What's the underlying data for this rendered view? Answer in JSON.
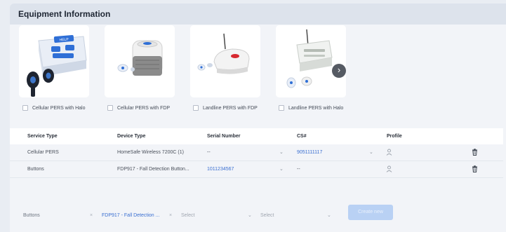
{
  "header": {
    "title": "Equipment Information"
  },
  "carousel": {
    "items": [
      {
        "label": "Cellular PERS with Halo"
      },
      {
        "label": "Cellular PERS with FDP"
      },
      {
        "label": "Landline PERS with FDP"
      },
      {
        "label": "Landline PERS with Halo"
      }
    ],
    "product_text": {
      "help": "HELP"
    }
  },
  "table": {
    "columns": [
      "Service Type",
      "Device Type",
      "Serial Number",
      "CS#",
      "Profile"
    ],
    "rows": [
      {
        "service_type": "Cellular PERS",
        "device_type": "HomeSafe Wireless 7200C (1)",
        "serial_number": "--",
        "cs": "9051111117"
      },
      {
        "service_type": "Buttons",
        "device_type": "FDP917 - Fall Detection Button...",
        "serial_number": "1011234567",
        "cs": "--"
      }
    ]
  },
  "add_row": {
    "service_type": "Buttons",
    "device_type": "FDP917 - Fall Detection ...",
    "select1_placeholder": "Select",
    "select2_placeholder": "Select",
    "create_button_label": "Create new"
  },
  "colors": {
    "accent_link": "#3a6fd1",
    "create_button": "#b9d1f4",
    "header_bg": "#dde3ec"
  },
  "icons": [
    "chevron-right-icon",
    "chevron-down-icon",
    "user-icon",
    "trash-icon",
    "clear-icon"
  ]
}
